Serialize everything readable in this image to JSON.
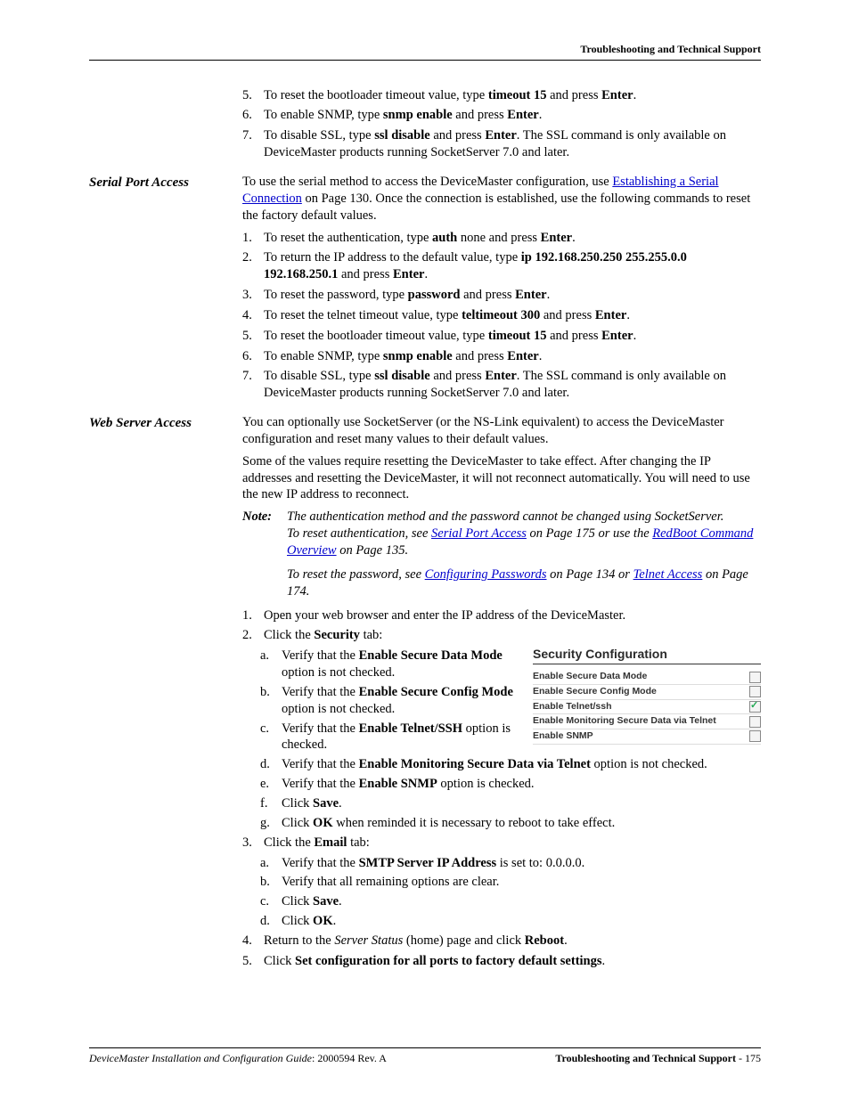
{
  "header": {
    "title": "Troubleshooting and Technical Support"
  },
  "footer": {
    "left_prefix_italic": "DeviceMaster Installation and Configuration Guide",
    "left_suffix": ": 2000594 Rev. A",
    "right_bold": "Troubleshooting and Technical Support",
    "right_page": "  - 175"
  },
  "top_list": {
    "i5": {
      "n": "5.",
      "pre": "To reset the bootloader timeout value, type ",
      "cmd": "timeout 15",
      "mid": " and press ",
      "key": "Enter",
      "post": "."
    },
    "i6": {
      "n": "6.",
      "pre": "To enable SNMP, type ",
      "cmd": "snmp enable",
      "mid": " and press ",
      "key": "Enter",
      "post": "."
    },
    "i7": {
      "n": "7.",
      "pre": "To disable SSL, type ",
      "cmd": "ssl disable",
      "mid": " and press ",
      "key": "Enter",
      "post": ". The SSL command is only available on DeviceMaster products running SocketServer 7.0 and later."
    }
  },
  "serial": {
    "heading": "Serial Port Access",
    "intro_pre": "To use the serial method to access the DeviceMaster configuration, use ",
    "intro_link": "Establishing a Serial Connection",
    "intro_post": " on Page 130. Once the connection is established, use the following commands to reset the factory default values.",
    "l1": {
      "n": "1.",
      "pre": "To reset the authentication, type ",
      "cmd": "auth",
      "mid": " none and press ",
      "key": "Enter",
      "post": "."
    },
    "l2": {
      "n": "2.",
      "pre": "To return the IP address to the default value, type ",
      "cmd": "ip 192.168.250.250 255.255.0.0 192.168.250.1",
      "mid": " and press ",
      "key": "Enter",
      "post": "."
    },
    "l3": {
      "n": "3.",
      "pre": "To reset the password, type ",
      "cmd": "password",
      "mid": " and press ",
      "key": "Enter",
      "post": "."
    },
    "l4": {
      "n": "4.",
      "pre": "To reset the telnet timeout value, type ",
      "cmd": "teltimeout 300",
      "mid": " and press ",
      "key": "Enter",
      "post": "."
    },
    "l5": {
      "n": "5.",
      "pre": "To reset the bootloader timeout value, type ",
      "cmd": "timeout 15",
      "mid": " and press ",
      "key": "Enter",
      "post": "."
    },
    "l6": {
      "n": "6.",
      "pre": "To enable SNMP, type ",
      "cmd": "snmp enable",
      "mid": " and press ",
      "key": "Enter",
      "post": "."
    },
    "l7": {
      "n": "7.",
      "pre": "To disable SSL, type ",
      "cmd": "ssl disable",
      "mid": " and press ",
      "key": "Enter",
      "post": ". The SSL command is only available on DeviceMaster products running SocketServer 7.0 and later."
    }
  },
  "web": {
    "heading": "Web Server Access",
    "p1": "You can optionally use SocketServer (or the NS-Link equivalent) to access the DeviceMaster configuration and reset many values to their default values.",
    "p2": "Some of the values require resetting the DeviceMaster to take effect. After changing the IP addresses and resetting the DeviceMaster, it will not reconnect automatically. You will need to use the new IP address to reconnect.",
    "note_label": "Note:",
    "note1": "The authentication method and the password cannot be changed using SocketServer.",
    "note2_pre": "To reset authentication, see ",
    "note2_link1": "Serial Port Access",
    "note2_mid1": " on Page 175 or use the ",
    "note2_link2": "RedBoot Command Overview",
    "note2_post": " on Page 135.",
    "note3_pre": "To reset the password, see ",
    "note3_link1": "Configuring Passwords",
    "note3_mid1": " on Page 134 or ",
    "note3_link2": "Telnet Access",
    "note3_post": " on Page 174.",
    "s1": {
      "n": "1.",
      "t": "Open your web browser and enter the IP address of the DeviceMaster."
    },
    "s2": {
      "n": "2.",
      "pre": "Click the ",
      "b": "Security",
      "post": " tab:"
    },
    "s2a": {
      "n": "a.",
      "pre": "Verify that the ",
      "b": "Enable Secure Data Mode",
      "post": " option is not checked."
    },
    "s2b": {
      "n": "b.",
      "pre": "Verify that the ",
      "b": "Enable Secure Config Mode",
      "post": " option is not checked."
    },
    "s2c": {
      "n": "c.",
      "pre": "Verify that the ",
      "b": "Enable Telnet/SSH",
      "post": " option is checked."
    },
    "s2d": {
      "n": "d.",
      "pre": "Verify that the ",
      "b": "Enable Monitoring Secure Data via Telnet",
      "post": " option is not checked."
    },
    "s2e": {
      "n": "e.",
      "pre": "Verify that the ",
      "b": "Enable SNMP",
      "post": " option is checked."
    },
    "s2f": {
      "n": "f.",
      "pre": "Click ",
      "b": "Save",
      "post": "."
    },
    "s2g": {
      "n": "g.",
      "pre": "Click ",
      "b": "OK",
      "post": " when reminded it is necessary to reboot to take effect."
    },
    "s3": {
      "n": "3.",
      "pre": "Click the ",
      "b": "Email",
      "post": " tab:"
    },
    "s3a": {
      "n": "a.",
      "pre": "Verify that the ",
      "b": "SMTP Server IP Address",
      "post": " is set to: 0.0.0.0."
    },
    "s3b": {
      "n": "b.",
      "t": "Verify that all remaining options are clear."
    },
    "s3c": {
      "n": "c.",
      "pre": "Click ",
      "b": "Save",
      "post": "."
    },
    "s3d": {
      "n": "d.",
      "pre": "Click ",
      "b": "OK",
      "post": "."
    },
    "s4": {
      "n": "4.",
      "pre": "Return to the ",
      "i": "Server Status",
      "mid": " (home) page and click ",
      "b": "Reboot",
      "post": "."
    },
    "s5": {
      "n": "5.",
      "pre": "Click ",
      "b": "Set configuration for all ports to factory default settings",
      "post": "."
    }
  },
  "panel": {
    "title": "Security Configuration",
    "r1": "Enable Secure Data Mode",
    "r2": "Enable Secure Config Mode",
    "r3": "Enable Telnet/ssh",
    "r4": "Enable Monitoring Secure Data via Telnet",
    "r5": "Enable SNMP"
  }
}
